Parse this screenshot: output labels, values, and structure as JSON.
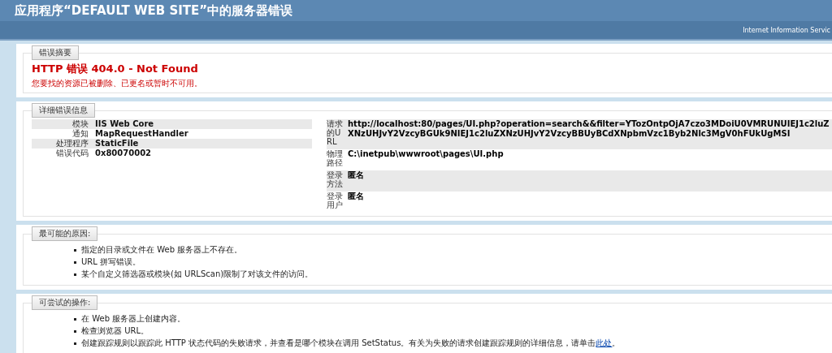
{
  "header": {
    "title": "应用程序“DEFAULT WEB SITE”中的服务器错误",
    "subtitle": "Internet Information Servic"
  },
  "summary": {
    "legend": "错误摘要",
    "heading": "HTTP 错误 404.0 - Not Found",
    "message": "您要找的资源已被删除、已更名或暂时不可用。"
  },
  "details": {
    "legend": "详细错误信息",
    "left": [
      {
        "label": "模块",
        "value": "IIS Web Core"
      },
      {
        "label": "通知",
        "value": "MapRequestHandler"
      },
      {
        "label": "处理程序",
        "value": "StaticFile"
      },
      {
        "label": "错误代码",
        "value": "0x80070002"
      }
    ],
    "right": [
      {
        "label": "请求的URL",
        "value": "http://localhost:80/pages/UI.php?operation=search&&filter=YTozOntpOjA7czo3MDoiU0VMRUNUIEJ1c2luZXNzUHJvY2VzcyBGUk9NIEJ1c2luZXNzUHJvY2VzcyBBUyBCdXNpbmVzc1Byb2Nlc3MgV0hFUkUgMSI"
      },
      {
        "label": "物理路径",
        "value": "C:\\inetpub\\wwwroot\\pages\\UI.php"
      },
      {
        "label": "登录方法",
        "value": "匿名"
      },
      {
        "label": "登录用户",
        "value": "匿名"
      }
    ]
  },
  "causes": {
    "legend": "最可能的原因:",
    "items": [
      {
        "text": "指定的目录或文件在 Web 服务器上不存在。"
      },
      {
        "text": "URL 拼写错误。"
      },
      {
        "text": "某个自定义筛选器或模块(如 URLScan)限制了对该文件的访问。"
      }
    ]
  },
  "actions": {
    "legend": "可尝试的操作:",
    "items": [
      {
        "text": "在 Web 服务器上创建内容。"
      },
      {
        "text": "检查浏览器 URL。"
      },
      {
        "text": "创建跟踪规则以跟踪此 HTTP 状态代码的失败请求，并查看是哪个模块在调用 SetStatus。有关为失败的请求创建跟踪规则的详细信息，请单击",
        "link": "此处",
        "after": "。"
      }
    ]
  }
}
